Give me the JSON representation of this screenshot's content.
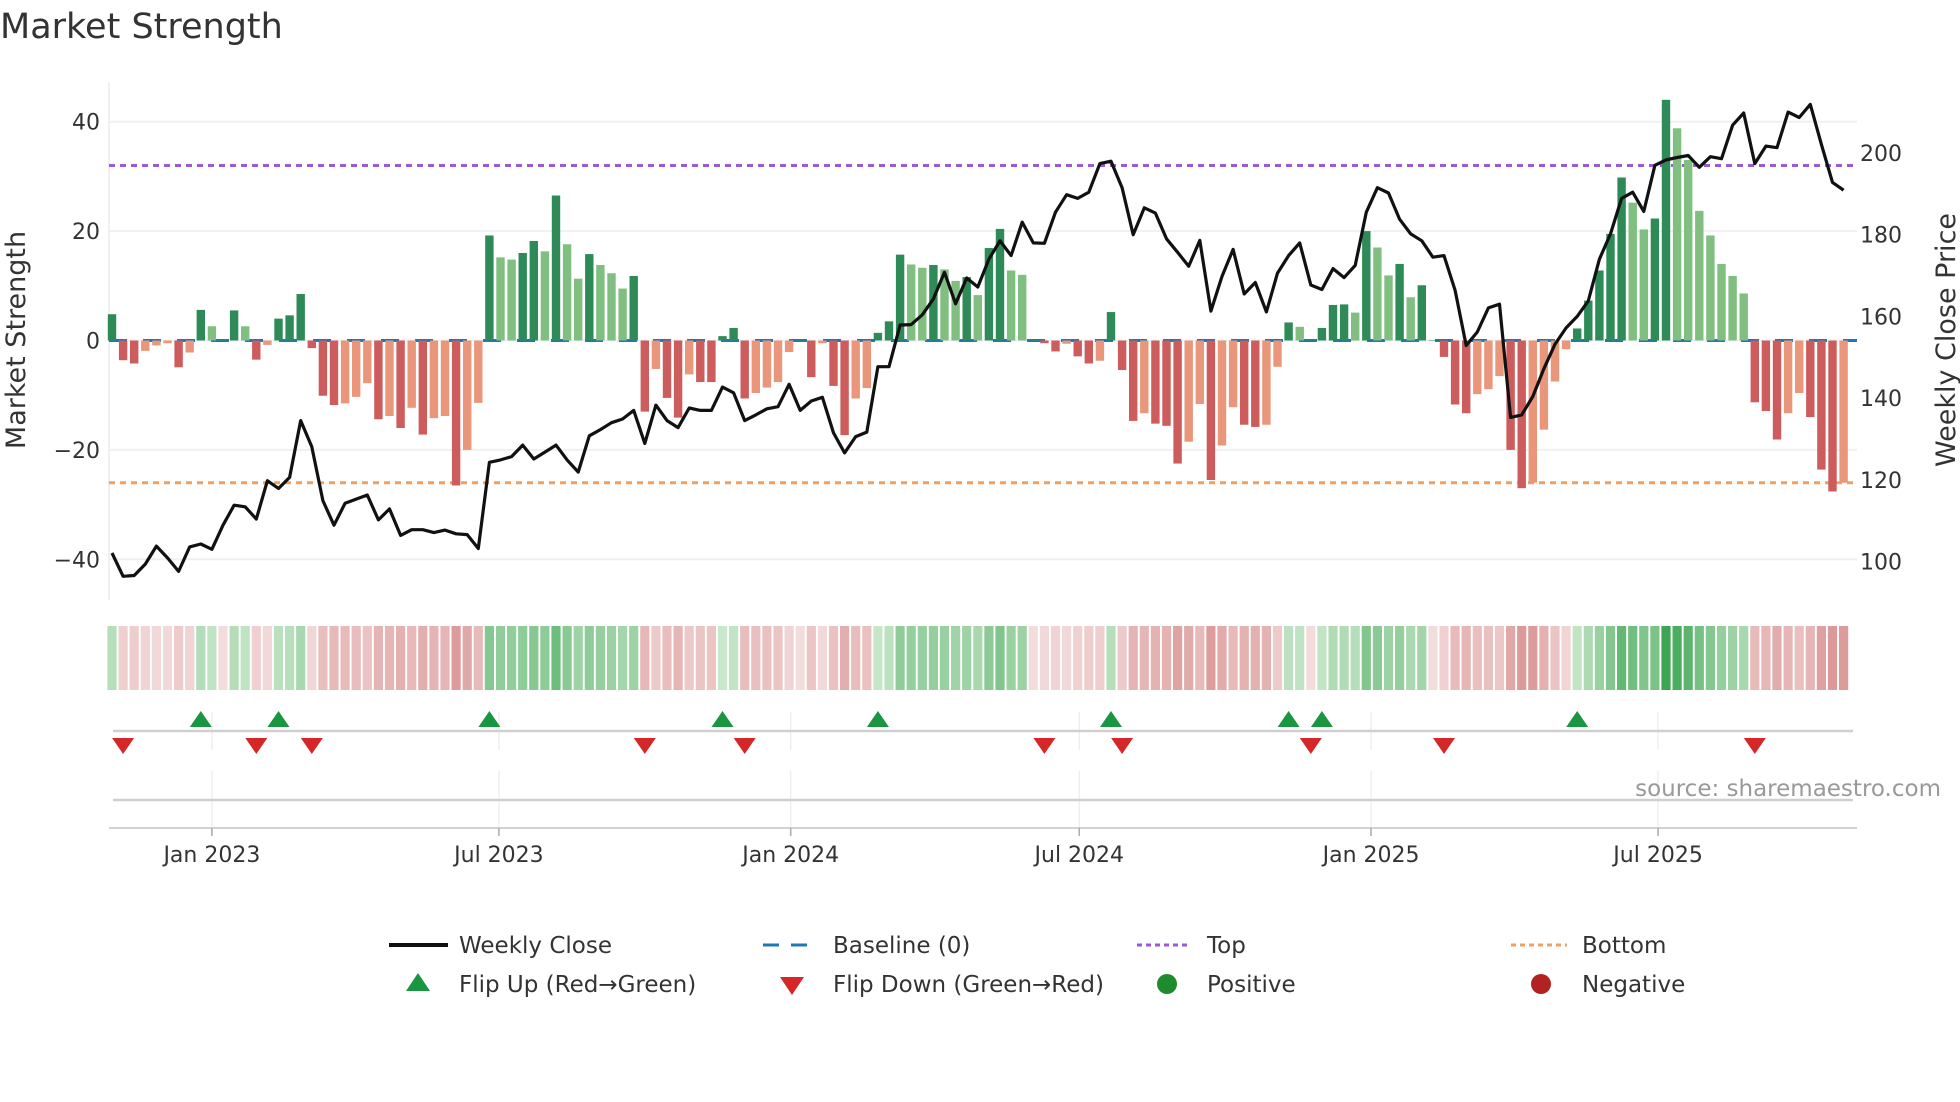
{
  "title": "Market Strength",
  "source": "source: sharemaestro.com",
  "colors": {
    "pos_strong": "#2e8b57",
    "pos_weak": "#80bf80",
    "neg_strong": "#cd5c5c",
    "neg_weak": "#e9967a",
    "close": "#111111",
    "baseline": "#1f77b4",
    "top": "#9b59d6",
    "bottom": "#f0a060",
    "flip_up": "#1a9641",
    "flip_down": "#d62728",
    "positive": "#1e8c2e",
    "negative": "#b22222"
  },
  "chart_data": {
    "type": "bar+line",
    "title": "Market Strength",
    "ylabel": "Market Strength",
    "y2label": "Weekly Close Price",
    "ylim": [
      -48,
      48
    ],
    "y2lim": [
      100,
      215
    ],
    "yticks": [
      40,
      20,
      0,
      -20,
      -40
    ],
    "y2ticks": [
      200,
      180,
      160,
      140,
      120,
      100
    ],
    "xticks": [
      {
        "label": "Jan 2023",
        "date": "2023-01-01"
      },
      {
        "label": "Jul 2023",
        "date": "2023-07-01"
      },
      {
        "label": "Jan 2024",
        "date": "2024-01-01"
      },
      {
        "label": "Jul 2024",
        "date": "2024-07-01"
      },
      {
        "label": "Jan 2025",
        "date": "2025-01-01"
      },
      {
        "label": "Jul 2025",
        "date": "2025-07-01"
      }
    ],
    "start_week": "2022-10-30",
    "interval_days": 7,
    "top": 32,
    "bottom": -26,
    "baseline": 0,
    "strength": [
      4.8,
      -3.6,
      -4.2,
      -1.9,
      -0.9,
      -0.5,
      -4.9,
      -2.2,
      5.6,
      2.6,
      0,
      5.5,
      2.6,
      -3.5,
      -0.8,
      4.0,
      4.6,
      8.5,
      -1.4,
      -10.1,
      -11.8,
      -11.5,
      -10.3,
      -7.8,
      -14.4,
      -13.8,
      -16,
      -12.3,
      -17.2,
      -14.2,
      -13.8,
      -26.5,
      -20,
      -11.4,
      19.2,
      15.2,
      14.8,
      16,
      18.2,
      16.3,
      26.5,
      17.6,
      11.3,
      15.8,
      13.8,
      12.3,
      9.5,
      11.8,
      -13,
      -5.2,
      -10.5,
      -14.1,
      -6.2,
      -7.6,
      -7.6,
      0.8,
      2.3,
      -10.6,
      -9.6,
      -8.6,
      -7.6,
      -2.1,
      0,
      -6.7,
      -0.5,
      -8.3,
      -17.3,
      -10.6,
      -8.7,
      1.4,
      3.5,
      15.7,
      13.9,
      13.3,
      13.8,
      13,
      10.9,
      11.6,
      8.3,
      16.9,
      20.4,
      12.8,
      12,
      0,
      -0.5,
      -2,
      -0.6,
      -2.9,
      -4.2,
      -3.7,
      5.2,
      -5.4,
      -14.7,
      -13.3,
      -15.2,
      -15.6,
      -22.5,
      -18.5,
      -11.6,
      -25.5,
      -19.2,
      -12.2,
      -15.4,
      -15.8,
      -15.4,
      -4.8,
      3.3,
      2.5,
      0,
      2.3,
      6.5,
      6.6,
      5.1,
      20,
      17,
      11.9,
      14,
      7.9,
      10.1,
      0,
      -3,
      -11.7,
      -13.3,
      -9.8,
      -8.9,
      -6.5,
      -20,
      -27,
      -26,
      -16.3,
      -7.5,
      -1.6,
      2.2,
      7.3,
      12.8,
      19.5,
      29.8,
      25.2,
      20.3,
      22.3,
      44,
      38.8,
      33,
      23.7,
      19.2,
      14,
      11.8,
      8.6,
      -11.3,
      -12.9,
      -18.1,
      -13.3,
      -9.6,
      -14,
      -23.6,
      -27.6,
      -26
    ],
    "close": [
      102.1,
      96.4,
      96.6,
      99.4,
      103.8,
      100.9,
      97.6,
      103.6,
      104.3,
      103,
      108.9,
      113.8,
      113.4,
      110.4,
      119.8,
      117.9,
      120.6,
      134.5,
      128.1,
      114.9,
      108.9,
      114.3,
      115.3,
      116.3,
      110.2,
      112.9,
      106.4,
      107.8,
      107.8,
      107.1,
      107.7,
      106.8,
      106.6,
      103.2,
      124.3,
      124.9,
      125.7,
      128.5,
      125.1,
      126.8,
      128.5,
      124.9,
      121.9,
      130.8,
      132.3,
      134,
      134.9,
      137,
      128.9,
      138.3,
      134.5,
      132.8,
      137.6,
      137,
      137,
      142.7,
      141.3,
      134.5,
      135.9,
      137.4,
      137.9,
      143.4,
      137,
      139.3,
      140.2,
      131.5,
      126.6,
      130.6,
      131.7,
      147.7,
      147.7,
      157.9,
      158,
      160.4,
      164.3,
      170.8,
      163.1,
      169.4,
      167.2,
      174,
      178.5,
      174.9,
      183.1,
      178,
      177.9,
      185.5,
      189.8,
      188.9,
      190.4,
      197.4,
      198,
      191.5,
      180,
      186.6,
      185.3,
      179,
      175.7,
      172.3,
      178.6,
      161.3,
      169.8,
      176.4,
      165.5,
      168.3,
      161.1,
      170.6,
      174.9,
      178,
      167.7,
      166.6,
      171.7,
      169.5,
      172.5,
      185.5,
      191.5,
      190.2,
      183.8,
      180.2,
      178.5,
      174.5,
      174.9,
      166.4,
      152.9,
      156.2,
      162.1,
      163,
      135.3,
      135.9,
      140.4,
      147.2,
      153.2,
      157.2,
      160,
      163.8,
      174,
      180.2,
      188.9,
      190.4,
      185.7,
      197,
      198.3,
      198.9,
      199.4,
      196.5,
      199.1,
      198.6,
      206.8,
      209.8,
      197.4,
      201.7,
      201.3,
      210,
      208.7,
      211.9,
      202.1,
      192.8,
      190.9
    ],
    "flip_up_weeks": [
      9,
      16,
      35,
      56,
      70,
      91,
      107,
      110,
      133
    ],
    "flip_down_weeks": [
      2,
      14,
      19,
      49,
      58,
      85,
      92,
      109,
      121,
      149
    ],
    "legend": [
      {
        "key": "close",
        "label": "Weekly Close"
      },
      {
        "key": "baseline",
        "label": "Baseline (0)"
      },
      {
        "key": "top",
        "label": "Top"
      },
      {
        "key": "bottom",
        "label": "Bottom"
      },
      {
        "key": "flip_up",
        "label": "Flip Up (Red→Green)"
      },
      {
        "key": "flip_down",
        "label": "Flip Down (Green→Red)"
      },
      {
        "key": "positive",
        "label": "Positive"
      },
      {
        "key": "negative",
        "label": "Negative"
      }
    ],
    "legend_position": "bottom"
  }
}
